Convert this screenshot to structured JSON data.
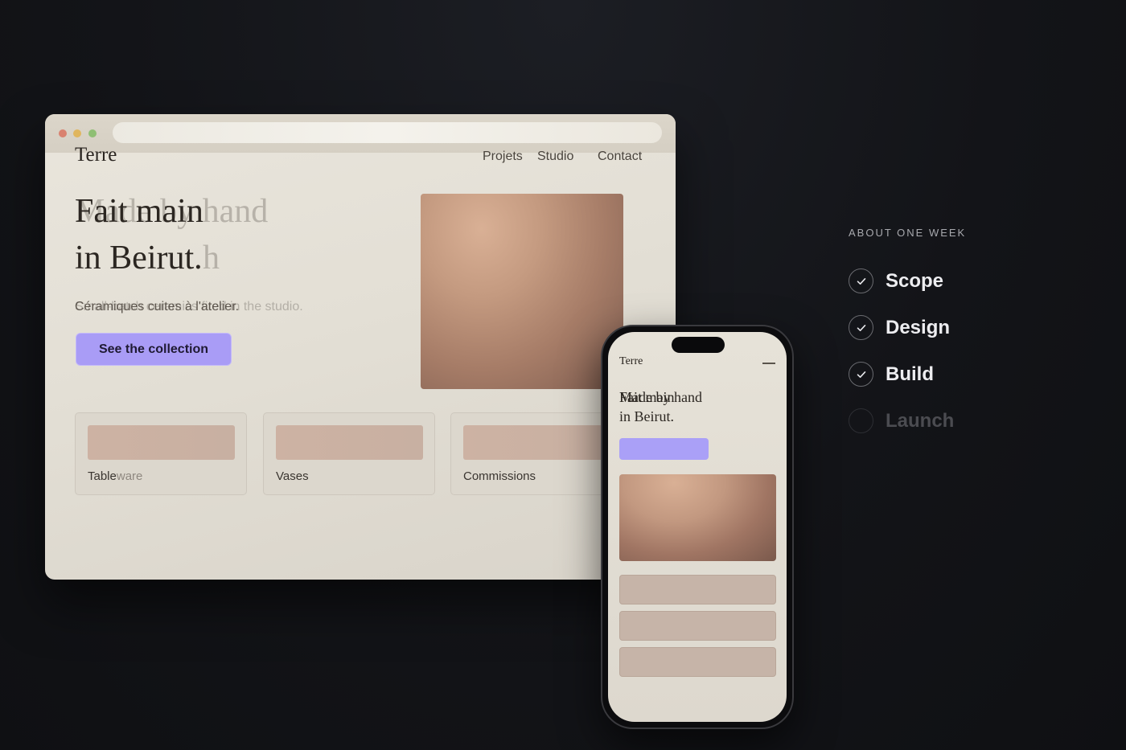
{
  "browser": {
    "site_logo": "Terre",
    "nav": [
      "Projets",
      "Studio",
      "Contact"
    ],
    "hero": {
      "line1": "Fait main",
      "line1_ghost": "Made by hand",
      "line2": "in Beirut.",
      "line2_ghost": "h",
      "subtitle": "Céramiques cuites à l'atelier.",
      "subtitle_ghost": "Small-batch ceramics fired in the studio.",
      "cta_label": "See the collection"
    },
    "cards": [
      {
        "label": "Table",
        "label_fade": "ware"
      },
      {
        "label": "Vases",
        "label_fade": ""
      },
      {
        "label": "Commissions",
        "label_fade": ""
      }
    ]
  },
  "phone": {
    "site_logo": "Terre",
    "hero_line1": "Fait main",
    "hero_line1_ghost": "Made by hand",
    "hero_line2": "in Beirut."
  },
  "timeline": {
    "title": "ABOUT ONE WEEK",
    "steps": [
      {
        "label": "Scope",
        "done": true
      },
      {
        "label": "Design",
        "done": true
      },
      {
        "label": "Build",
        "done": true
      },
      {
        "label": "Launch",
        "done": false
      }
    ]
  },
  "colors": {
    "accent": "#a99cf6",
    "background": "#131418",
    "page": "#e6e2d8",
    "terracotta": "#c49a80"
  }
}
